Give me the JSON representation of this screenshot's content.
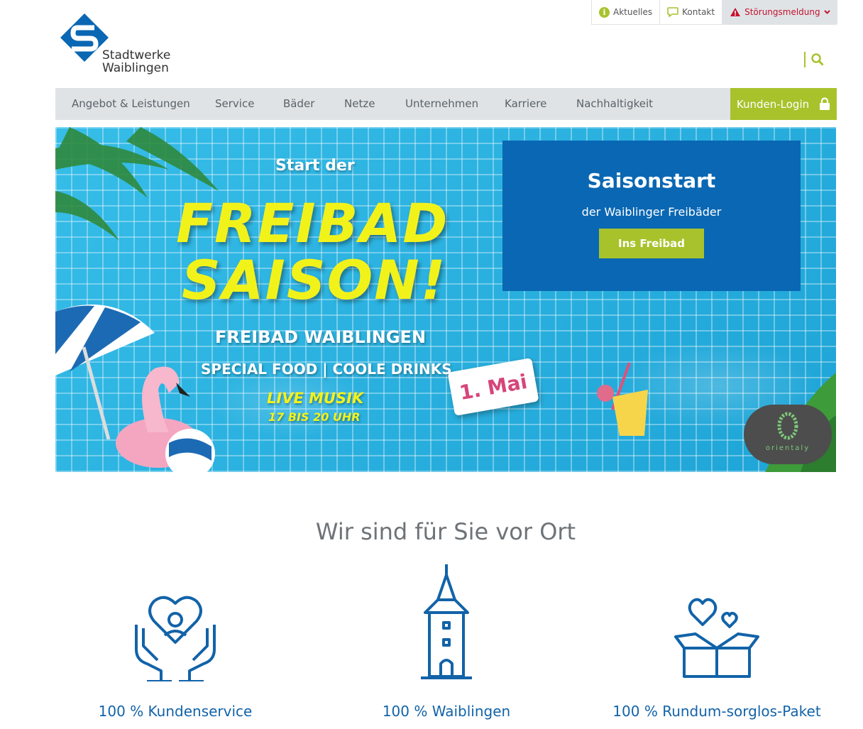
{
  "util": {
    "aktuelles": "Aktuelles",
    "kontakt": "Kontakt",
    "stoerung": "Störungsmeldung"
  },
  "logo": {
    "line1": "Stadtwerke",
    "line2": "Waiblingen"
  },
  "nav": {
    "items": [
      "Angebot & Leistungen",
      "Service",
      "Bäder",
      "Netze",
      "Unternehmen",
      "Karriere",
      "Nachhaltigkeit"
    ],
    "login": "Kunden-Login"
  },
  "hero": {
    "start": "Start der",
    "line1": "FREIBAD",
    "line2": "SAISON!",
    "sub1": "FREIBAD WAIBLINGEN",
    "sub2": "SPECIAL FOOD | COOLE DRINKS",
    "live1": "LIVE MUSIK",
    "live2": "17 BIS 20 UHR",
    "date": "1. Mai",
    "box_title": "Saisonstart",
    "box_text": "der Waiblinger Freibäder",
    "box_button": "Ins Freibad",
    "badge_text": "orientaly"
  },
  "section": {
    "title": "Wir sind für Sie vor Ort",
    "features": [
      "100 % Kundenservice",
      "100 % Waiblingen",
      "100 % Rundum-sorglos-Paket"
    ]
  },
  "colors": {
    "accent": "#a8c22c",
    "brand": "#0a67b3",
    "nav_bg": "#dfe3e6",
    "alert": "#c4122f"
  }
}
